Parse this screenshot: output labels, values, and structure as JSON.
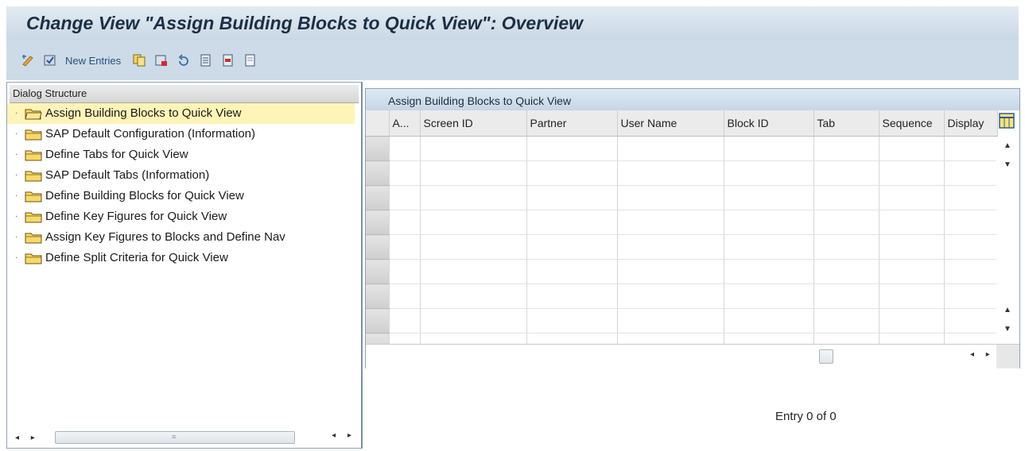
{
  "window": {
    "title": "Change View \"Assign Building Blocks to Quick View\": Overview"
  },
  "toolbar": {
    "new_entries_label": "New Entries",
    "icons": [
      "display-change-icon",
      "check-icon",
      "copy-icon",
      "delete-icon",
      "undo-icon",
      "select-all-icon",
      "select-block-icon",
      "deselect-all-icon"
    ]
  },
  "dialog_structure": {
    "header": "Dialog Structure",
    "items": [
      {
        "label": "Assign Building Blocks to Quick View",
        "selected": true
      },
      {
        "label": "SAP Default Configuration (Information)"
      },
      {
        "label": "Define Tabs for Quick View"
      },
      {
        "label": "SAP Default Tabs (Information)"
      },
      {
        "label": "Define Building Blocks for Quick View"
      },
      {
        "label": "Define Key Figures for Quick View"
      },
      {
        "label": "Assign Key Figures to Blocks and Define Nav"
      },
      {
        "label": "Define Split Criteria for Quick View"
      }
    ]
  },
  "table": {
    "title": "Assign Building Blocks to Quick View",
    "columns": [
      "A...",
      "Screen ID",
      "Partner",
      "User Name",
      "Block ID",
      "Tab",
      "Sequence",
      "Display"
    ],
    "row_count": 9
  },
  "status": {
    "entry_text": "Entry 0 of 0"
  },
  "colors": {
    "title_bg": "#c9d8e5",
    "toolbar_bg": "#ccdbe7",
    "selected_item_bg": "#fff4b8",
    "link_text": "#2a4d7d"
  }
}
